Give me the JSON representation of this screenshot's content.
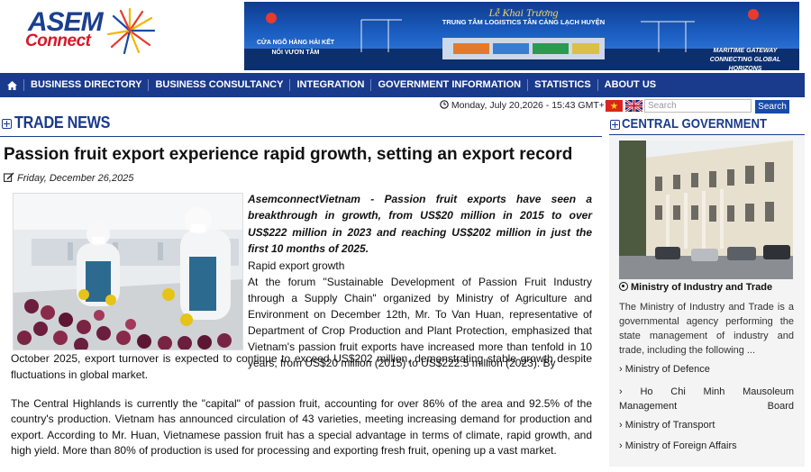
{
  "logo": {
    "line1": "ASEM",
    "line2": "Connect"
  },
  "banner": {
    "title": "Lễ Khai Trương",
    "subtitle": "TRUNG TÂM LOGISTICS TÂN CẢNG LẠCH HUYỆN",
    "left_text": "CỬA NGÕ HÀNG HẢI KẾT NỐI VƯƠN TẦM",
    "right_text": "MARITIME GATEWAY CONNECTING GLOBAL HORIZONS"
  },
  "nav": {
    "items": [
      {
        "label": "BUSINESS DIRECTORY"
      },
      {
        "label": "BUSINESS CONSULTANCY"
      },
      {
        "label": "INTEGRATION"
      },
      {
        "label": "GOVERNMENT INFORMATION"
      },
      {
        "label": "STATISTICS"
      },
      {
        "label": "ABOUT US"
      }
    ]
  },
  "topbar": {
    "datetime": "Monday, July 20,2026 - 15:43 GMT+7",
    "search_placeholder": "Search",
    "search_button": "Search"
  },
  "section": {
    "title": "TRADE NEWS"
  },
  "article": {
    "title": "Passion fruit export experience rapid growth, setting an export record",
    "date": "Friday, December 26,2025",
    "lead": "AsemconnectVietnam - Passion fruit exports have seen a breakthrough in growth, from US$20 million in 2015 to over US$222 million in 2023 and reaching US$202 million in just the first 10 months of 2025.",
    "subheading": "Rapid export growth",
    "para1_wrap": "At the forum \"Sustainable Development of Passion Fruit Industry through a Supply Chain\" organized by Ministry of Agriculture and Environment on December 12th, Mr. To Van Huan, representative of Department of Crop Production and Plant Protection, emphasized that Vietnam's passion fruit exports have increased more than tenfold in 10 years, from US$20 million (2015) to US$222.5 million (2023). By",
    "para1_full": "October 2025, export turnover is expected to continue to exceed US$202 million, demonstrating stable growth despite fluctuations in global market.",
    "para2": "The Central Highlands is currently the \"capital\" of passion fruit, accounting for over 86% of the area and 92.5% of the country's production. Vietnam has announced circulation of 43 varieties, meeting increasing demand for production and export. According to Mr. Huan, Vietnamese passion fruit has a special advantage in terms of climate, rapid growth, and high yield. More than 80% of production is used for processing and exporting fresh fruit, opening up a vast market."
  },
  "sidebar": {
    "title": "CENTRAL GOVERNMENT",
    "caption": "Ministry of Industry and Trade",
    "description": "The Ministry of Industry and Trade is a governmental agency performing the state management of industry and trade, including the following ...",
    "links": [
      {
        "label": "Ministry of Defence"
      },
      {
        "label": "Ho Chi Minh Mausoleum Management Board"
      },
      {
        "label": "Ministry of Transport"
      },
      {
        "label": "Ministry of Foreign Affairs"
      }
    ]
  },
  "colors": {
    "brand_blue": "#1a3a8c",
    "brand_red": "#d8182a",
    "search_button": "#1a4aa8"
  }
}
